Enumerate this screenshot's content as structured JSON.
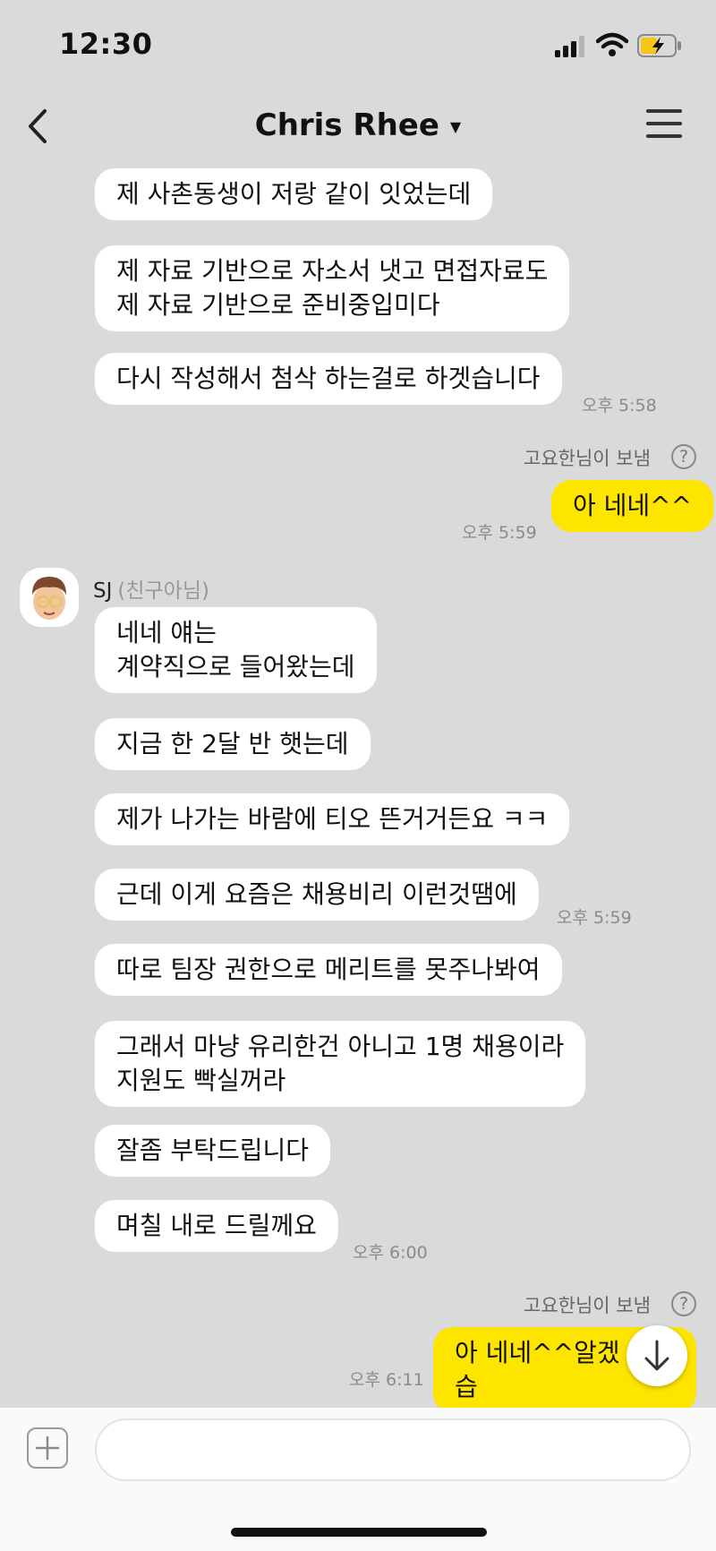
{
  "status_bar": {
    "time": "12:30"
  },
  "header": {
    "title": "Chris Rhee"
  },
  "messages": {
    "m1": "제 사촌동생이 저랑 같이 잇었는데",
    "m2": "제 자료 기반으로 자소서 냇고 면접자료도\n제 자료 기반으로 준비중입미다",
    "m3": "다시 작성해서 첨삭 하는걸로 하겟습니다",
    "t1": "오후 5:58",
    "sent_by_1": "고요한님이 보냄",
    "help_1": "?",
    "mine1": "아 네네^^",
    "t2": "오후 5:59",
    "sender_name": "SJ",
    "sender_tag": "(친구아님)",
    "m4": "네네 얘는\n계약직으로 들어왔는데",
    "m5": "지금 한 2달 반 햇는데",
    "m6": "제가 나가는 바람에 티오 뜬거거든요 ㅋㅋ",
    "m7": "근데 이게 요즘은 채용비리 이런것땜에",
    "t3": "오후 5:59",
    "m8": "따로 팀장 권한으로 메리트를 못주나봐여",
    "m9": "그래서 마냥 유리한건 아니고 1명 채용이라\n 지원도 빡실꺼라",
    "m10": "잘좀 부탁드립니다",
    "m11": "며칠 내로 드릴께요",
    "t4": "오후 6:00",
    "sent_by_2": "고요한님이 보냄",
    "help_2": "?",
    "mine2": "아 네네^^알겠습",
    "t5": "오후 6:11"
  },
  "input": {
    "value": "",
    "placeholder": ""
  },
  "colors": {
    "background": "#dadada",
    "my_bubble": "#fee500",
    "their_bubble": "#ffffff"
  },
  "icons": [
    "back-icon",
    "menu-icon",
    "scroll-down-icon",
    "add-icon",
    "help-icon",
    "avatar"
  ]
}
